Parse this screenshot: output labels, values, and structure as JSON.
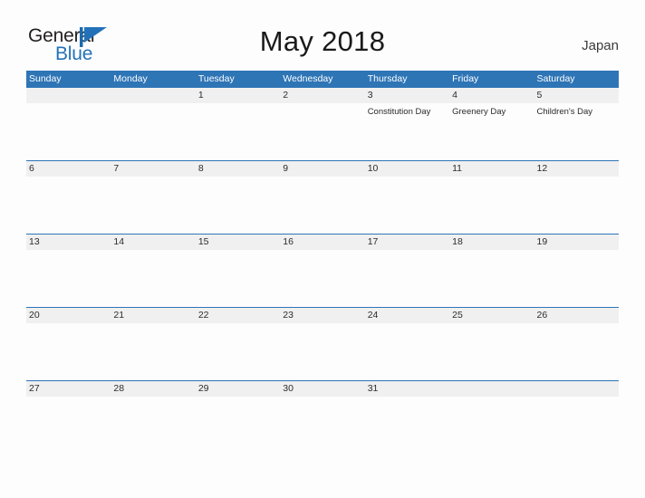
{
  "branding": {
    "logo_primary": "General",
    "logo_secondary": "Blue",
    "logo_icon": "blue-flag-triangle-icon",
    "primary_color": "#231f20",
    "secondary_color": "#2372b9"
  },
  "header": {
    "title": "May 2018",
    "country": "Japan"
  },
  "colors": {
    "header_blue": "#2e75b6",
    "row_band_gray": "#f0f0f0",
    "page_background": "#fdfdfd",
    "text_dark": "#2b2b2b"
  },
  "calendar": {
    "month": "May",
    "year": "2018",
    "weekday_headers": [
      "Sunday",
      "Monday",
      "Tuesday",
      "Wednesday",
      "Thursday",
      "Friday",
      "Saturday"
    ],
    "weeks": [
      {
        "days": [
          {
            "num": "",
            "event": ""
          },
          {
            "num": "",
            "event": ""
          },
          {
            "num": "1",
            "event": ""
          },
          {
            "num": "2",
            "event": ""
          },
          {
            "num": "3",
            "event": "Constitution Day"
          },
          {
            "num": "4",
            "event": "Greenery Day"
          },
          {
            "num": "5",
            "event": "Children's Day"
          }
        ]
      },
      {
        "days": [
          {
            "num": "6",
            "event": ""
          },
          {
            "num": "7",
            "event": ""
          },
          {
            "num": "8",
            "event": ""
          },
          {
            "num": "9",
            "event": ""
          },
          {
            "num": "10",
            "event": ""
          },
          {
            "num": "11",
            "event": ""
          },
          {
            "num": "12",
            "event": ""
          }
        ]
      },
      {
        "days": [
          {
            "num": "13",
            "event": ""
          },
          {
            "num": "14",
            "event": ""
          },
          {
            "num": "15",
            "event": ""
          },
          {
            "num": "16",
            "event": ""
          },
          {
            "num": "17",
            "event": ""
          },
          {
            "num": "18",
            "event": ""
          },
          {
            "num": "19",
            "event": ""
          }
        ]
      },
      {
        "days": [
          {
            "num": "20",
            "event": ""
          },
          {
            "num": "21",
            "event": ""
          },
          {
            "num": "22",
            "event": ""
          },
          {
            "num": "23",
            "event": ""
          },
          {
            "num": "24",
            "event": ""
          },
          {
            "num": "25",
            "event": ""
          },
          {
            "num": "26",
            "event": ""
          }
        ]
      },
      {
        "days": [
          {
            "num": "27",
            "event": ""
          },
          {
            "num": "28",
            "event": ""
          },
          {
            "num": "29",
            "event": ""
          },
          {
            "num": "30",
            "event": ""
          },
          {
            "num": "31",
            "event": ""
          },
          {
            "num": "",
            "event": ""
          },
          {
            "num": "",
            "event": ""
          }
        ]
      }
    ]
  }
}
